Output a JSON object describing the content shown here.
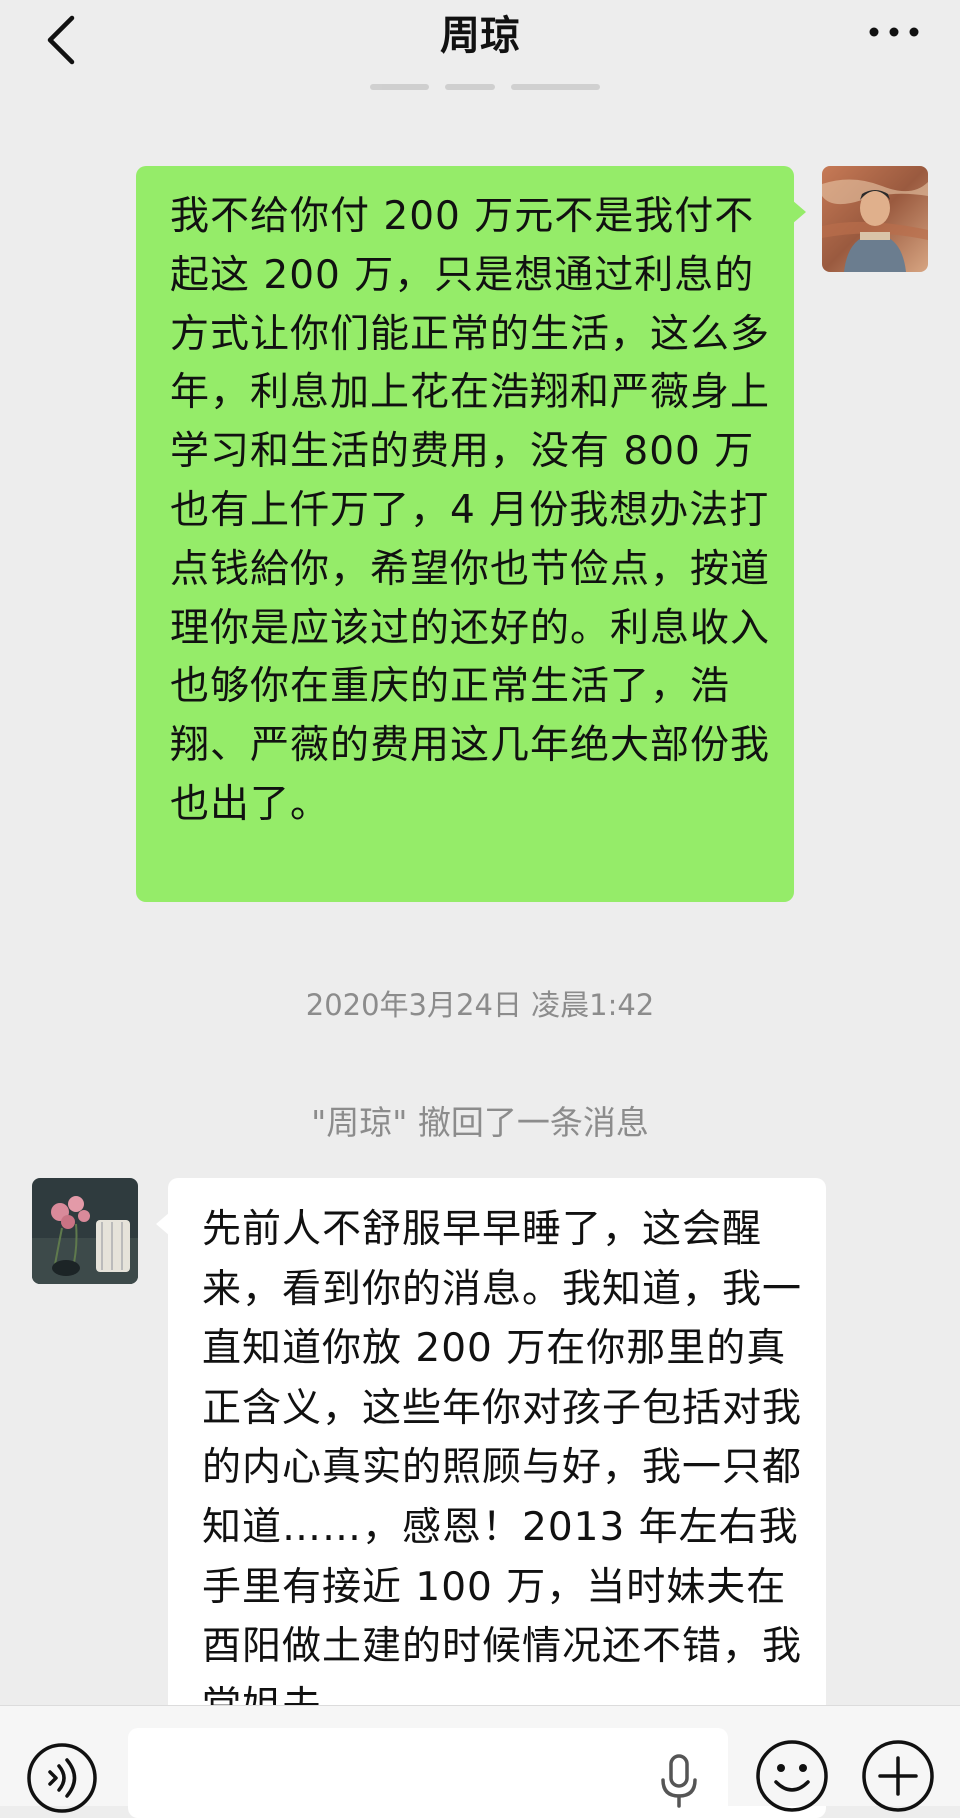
{
  "header": {
    "title": "周琼",
    "back_icon": "back-chevron-icon",
    "more_icon": "more-dots-icon"
  },
  "messages": [
    {
      "side": "right",
      "avatar_icon": "contact-photo-man",
      "text": "我不给你付 200 万元不是我付不起这 200 万，只是想通过利息的方式让你们能正常的生活，这么多年，利息加上花在浩翔和严薇身上学习和生活的费用，没有 800 万也有上仟万了，4 月份我想办法打点钱給你，希望你也节俭点，按道理你是应该过的还好的。利息收入也够你在重庆的正常生活了，浩翔、严薇的费用这几年绝大部份我也出了。"
    },
    {
      "side": "left",
      "avatar_icon": "contact-photo-flowers-lamp",
      "text": "先前人不舒服早早睡了，这会醒来，看到你的消息。我知道，我一直知道你放 200 万在你那里的真正含义，这些年你对孩子包括对我的内心真实的照顾与好，我一只都知道……，感恩！2013 年左右我手里有接近 100 万，当时妹夫在酉阳做土建的时候情况还不错，我堂姐夫"
    }
  ],
  "timestamp": "2020年3月24日 凌晨1:42",
  "system_notice": "\"周琼\" 撤回了一条消息",
  "input_bar": {
    "voice_icon": "voice-mode-icon",
    "mic_icon": "microphone-icon",
    "emoji_icon": "emoji-icon",
    "plus_icon": "plus-icon"
  },
  "colors": {
    "background": "#ededed",
    "sent_bubble": "#95ec69",
    "received_bubble": "#ffffff",
    "meta_text": "#8c8c8c"
  }
}
